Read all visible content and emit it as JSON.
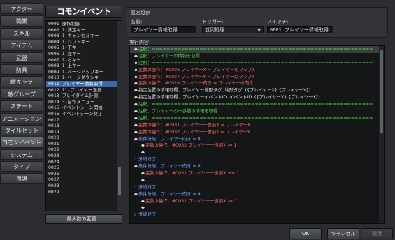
{
  "tabs": [
    "アクター",
    "職業",
    "スキル",
    "アイテム",
    "武器",
    "防具",
    "敵キャラ",
    "敵グループ",
    "ステート",
    "アニメーション",
    "タイルセット",
    "コモンイベント",
    "システム",
    "タイプ",
    "用語"
  ],
  "active_tab_index": 11,
  "common_events": {
    "title": "コモンイベント",
    "items": [
      "0001 操作制御",
      "0002 1-決定キー",
      "0003 1-キャンセルキー",
      "0004 1-シフトキー",
      "0005 1-下キー",
      "0006 1-左キー",
      "0007 1-右キー",
      "0008 1-上キー",
      "0009 1-ページアップキー",
      "0010 1-ページダウンキー",
      "0011 プレイヤー情報取得",
      "0012 11-プレイヤー足音",
      "0013 プレイタイム計測",
      "0014 3-自作メニュー",
      "0015 イベントシーン開始",
      "0016 イベントシーン終了",
      "0017",
      "0018",
      "0019",
      "0020",
      "0021",
      "0022",
      "0023",
      "0024",
      "0025",
      "0026",
      "0027",
      "0028",
      "0029"
    ],
    "selected_index": 10,
    "max_button": "最大数の変更..."
  },
  "basic": {
    "title": "基本設定",
    "name_label": "名前:",
    "name_value": "プレイヤー情報取得",
    "trigger_label": "トリガー:",
    "trigger_value": "並列処理",
    "switch_label": "スイッチ:",
    "switch_value": "0001 プレイヤー情報取得"
  },
  "exec": {
    "title": "実行内容",
    "lines": [
      {
        "indent": 0,
        "marker": "◆",
        "color": "green",
        "text": "注釈：============================================================"
      },
      {
        "indent": 0,
        "marker": "◆",
        "color": "green",
        "text": "注釈：プレイヤーの情報を取得"
      },
      {
        "indent": 0,
        "marker": "◆",
        "color": "green",
        "text": "注釈：============================================================"
      },
      {
        "indent": 0,
        "marker": "◆",
        "color": "red",
        "text": "変数の操作：#0026 プレイヤーX = プレイヤーのマップX"
      },
      {
        "indent": 0,
        "marker": "◆",
        "color": "red",
        "text": "変数の操作：#0027 プレイヤーY = プレイヤーのマップY"
      },
      {
        "indent": 0,
        "marker": "◆",
        "color": "red",
        "text": "変数の操作：#0028 プレイヤー向き = プレイヤーの向き"
      },
      {
        "indent": 0,
        "marker": "◆",
        "color": "white",
        "text": "指定位置の情報取得：プレイヤー地形タグ, 地形タグ, ({プレイヤーX},{プレイヤーY})"
      },
      {
        "indent": 0,
        "marker": "◆",
        "color": "white",
        "text": "指定位置の情報取得：プレイヤーイベントID, イベントID, ({プレイヤーX},{プレイヤーY})"
      },
      {
        "indent": 0,
        "marker": "◆",
        "color": "green",
        "text": "注釈：============================================================"
      },
      {
        "indent": 0,
        "marker": "◆",
        "color": "green",
        "text": "注釈：プレイヤーの一歩前の情報を取得"
      },
      {
        "indent": 0,
        "marker": "◆",
        "color": "green",
        "text": "注釈：============================================================"
      },
      {
        "indent": 0,
        "marker": "◆",
        "color": "red",
        "text": "変数の操作：#0031 プレイヤー一歩前X = プレイヤーX"
      },
      {
        "indent": 0,
        "marker": "◆",
        "color": "red",
        "text": "変数の操作：#0032 プレイヤー一歩前Y = プレイヤーY"
      },
      {
        "indent": 0,
        "marker": "◆",
        "color": "blue",
        "text": "条件分岐：プレイヤー向き = 8"
      },
      {
        "indent": 1,
        "marker": "◆",
        "color": "red",
        "text": "変数の操作：#0032 プレイヤー一歩前Y -= 1"
      },
      {
        "indent": 1,
        "marker": "◆",
        "color": "white",
        "text": ""
      },
      {
        "indent": 0,
        "marker": ":",
        "color": "blue",
        "text": "分岐終了"
      },
      {
        "indent": 0,
        "marker": "◆",
        "color": "blue",
        "text": "条件分岐：プレイヤー向き = 6"
      },
      {
        "indent": 1,
        "marker": "◆",
        "color": "red",
        "text": "変数の操作：#0031 プレイヤー一歩前X += 1"
      },
      {
        "indent": 1,
        "marker": "◆",
        "color": "white",
        "text": ""
      },
      {
        "indent": 0,
        "marker": ":",
        "color": "blue",
        "text": "分岐終了"
      },
      {
        "indent": 0,
        "marker": "◆",
        "color": "blue",
        "text": "条件分岐：プレイヤー向き = 4"
      },
      {
        "indent": 1,
        "marker": "◆",
        "color": "red",
        "text": "変数の操作：#0031 プレイヤー一歩前X -= 1"
      },
      {
        "indent": 1,
        "marker": "◆",
        "color": "white",
        "text": ""
      },
      {
        "indent": 0,
        "marker": ":",
        "color": "blue",
        "text": "分岐終了"
      }
    ]
  },
  "buttons": {
    "ok": "OK",
    "cancel": "キャンセル",
    "apply": "適用"
  }
}
